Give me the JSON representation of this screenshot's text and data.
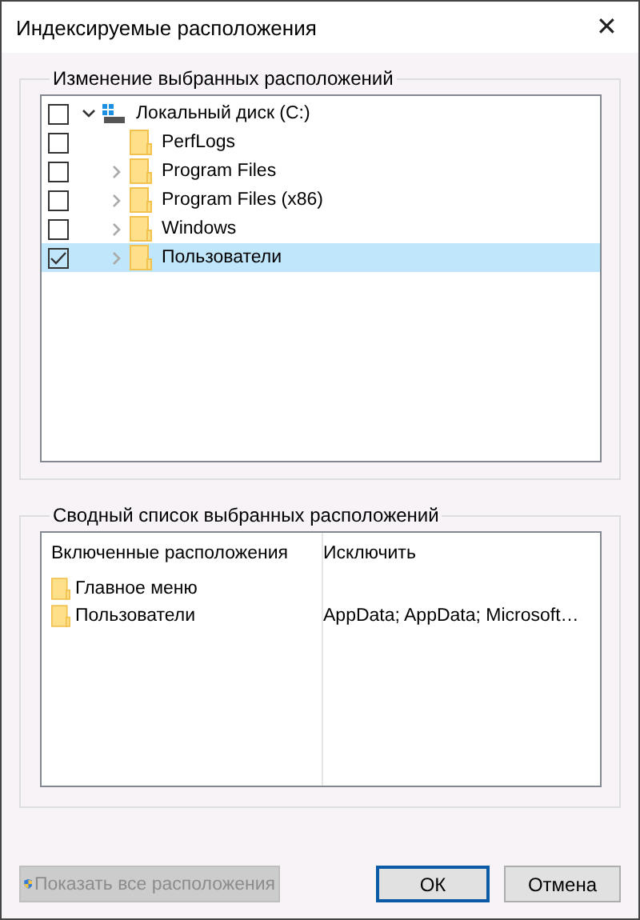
{
  "window": {
    "title": "Индексируемые расположения",
    "close": "✕"
  },
  "locations": {
    "legend": "Изменение выбранных расположений",
    "tree": [
      {
        "label": "Локальный диск (C:)",
        "kind": "drive",
        "checked": false,
        "expandable": true,
        "expanded": true,
        "selected": false,
        "children": [
          {
            "label": "PerfLogs",
            "kind": "folder",
            "checked": false,
            "expandable": false,
            "selected": false
          },
          {
            "label": "Program Files",
            "kind": "folder",
            "checked": false,
            "expandable": true,
            "selected": false
          },
          {
            "label": "Program Files (x86)",
            "kind": "folder",
            "checked": false,
            "expandable": true,
            "selected": false
          },
          {
            "label": "Windows",
            "kind": "folder",
            "checked": false,
            "expandable": true,
            "selected": false
          },
          {
            "label": "Пользователи",
            "kind": "folder",
            "checked": true,
            "expandable": true,
            "selected": true
          }
        ]
      }
    ]
  },
  "summary": {
    "legend": "Сводный список выбранных расположений",
    "columns": [
      "Включенные расположения",
      "Исключить"
    ],
    "rows": [
      {
        "name": "Главное меню"
      },
      {
        "name": "Пользователи",
        "exclude": "AppData; AppData; Microsoft…"
      }
    ]
  },
  "buttons": [
    {
      "label": "Показать все расположения",
      "kind": "shield",
      "disabled": true,
      "default": false
    },
    {
      "label": "ОК",
      "kind": "plain",
      "disabled": false,
      "default": true
    },
    {
      "label": "Отмена",
      "kind": "plain",
      "disabled": false,
      "default": false
    }
  ]
}
